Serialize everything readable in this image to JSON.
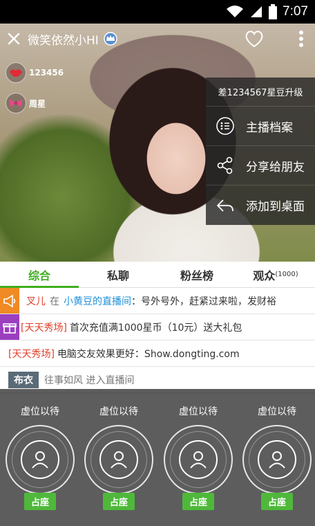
{
  "status_bar": {
    "time": "7:07"
  },
  "header": {
    "title": "微笑依然小HI"
  },
  "stats": {
    "fans": "123456",
    "star": "周星"
  },
  "menu": {
    "upgrade": "差1234567星豆升级",
    "items": [
      {
        "label": "主播档案",
        "icon": "profile-icon"
      },
      {
        "label": "分享给朋友",
        "icon": "share-icon"
      },
      {
        "label": "添加到桌面",
        "icon": "back-arrow-icon"
      }
    ]
  },
  "tabs": [
    {
      "label": "综合"
    },
    {
      "label": "私聊"
    },
    {
      "label": "粉丝榜"
    },
    {
      "label": "观众",
      "count": "(1000)"
    }
  ],
  "chat": {
    "row1": {
      "name": "叉儿",
      "mid": "在",
      "room": "小黄豆的直播间",
      "text": "：号外号外，赶紧过来啦，发财裕"
    },
    "row2": {
      "tag": "[天天秀场]",
      "text": "首次充值满1000星币（10元）送大礼包"
    },
    "row3": {
      "tag": "[天天秀场]",
      "text": "电脑交友效果更好：Show.dongting.com"
    },
    "row4": {
      "badge": "布衣",
      "text": "往事如风   进入直播间"
    }
  },
  "seats": [
    {
      "label": "虚位以待",
      "action": "占座"
    },
    {
      "label": "虚位以待",
      "action": "占座"
    },
    {
      "label": "虚位以待",
      "action": "占座"
    },
    {
      "label": "虚位以待",
      "action": "占座"
    }
  ]
}
